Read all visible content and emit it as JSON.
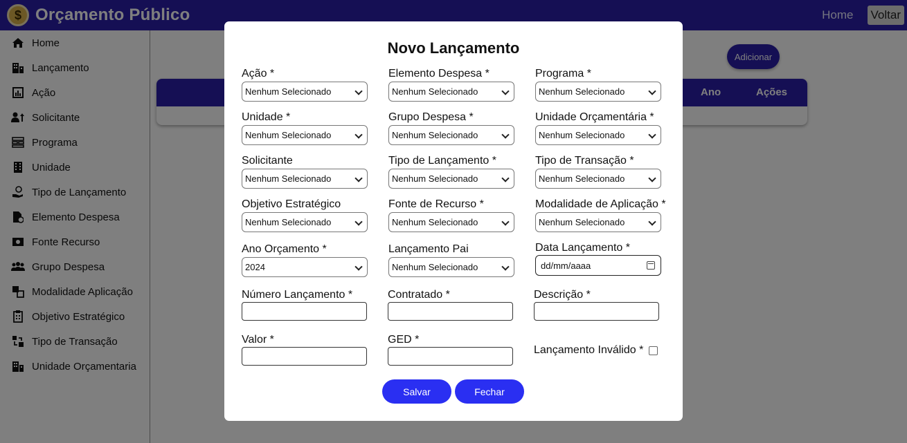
{
  "header": {
    "title": "Orçamento Público",
    "logo_symbol": "$",
    "nav_home": "Home",
    "nav_back": "Voltar"
  },
  "sidebar": {
    "items": [
      {
        "label": "Home",
        "icon": "home-icon"
      },
      {
        "label": "Lançamento",
        "icon": "building-icon"
      },
      {
        "label": "Ação",
        "icon": "bar-chart-icon"
      },
      {
        "label": "Solicitante",
        "icon": "user-up-icon"
      },
      {
        "label": "Programa",
        "icon": "sitemap-icon"
      },
      {
        "label": "Unidade",
        "icon": "office-building-icon"
      },
      {
        "label": "Tipo de Lançamento",
        "icon": "hand-coin-icon"
      },
      {
        "label": "Elemento Despesa",
        "icon": "document-money-icon"
      },
      {
        "label": "Fonte Recurso",
        "icon": "banknote-icon"
      },
      {
        "label": "Grupo Despesa",
        "icon": "users-group-icon"
      },
      {
        "label": "Modalidade Aplicação",
        "icon": "boxes-icon"
      },
      {
        "label": "Objetivo Estratégico",
        "icon": "clipboard-icon"
      },
      {
        "label": "Tipo de Transação",
        "icon": "transfer-icon"
      },
      {
        "label": "Unidade Orçamentaria",
        "icon": "buildings-icon"
      }
    ]
  },
  "main": {
    "add_button": "Adicionar",
    "table_headers": [
      "Ano",
      "Ações"
    ]
  },
  "modal": {
    "title": "Novo Lançamento",
    "selects": [
      {
        "label": "Ação *",
        "value": "Nenhum Selecionado"
      },
      {
        "label": "Elemento Despesa *",
        "value": "Nenhum Selecionado"
      },
      {
        "label": "Programa *",
        "value": "Nenhum Selecionado"
      },
      {
        "label": "Unidade *",
        "value": "Nenhum Selecionado"
      },
      {
        "label": "Grupo Despesa *",
        "value": "Nenhum Selecionado"
      },
      {
        "label": "Unidade Orçamentária *",
        "value": "Nenhum Selecionado"
      },
      {
        "label": "Solicitante",
        "value": "Nenhum Selecionado"
      },
      {
        "label": "Tipo de Lançamento *",
        "value": "Nenhum Selecionado"
      },
      {
        "label": "Tipo de Transação *",
        "value": "Nenhum Selecionado"
      },
      {
        "label": "Objetivo Estratégico",
        "value": "Nenhum Selecionado"
      },
      {
        "label": "Fonte de Recurso *",
        "value": "Nenhum Selecionado"
      },
      {
        "label": "Modalidade de Aplicação *",
        "value": "Nenhum Selecionado"
      },
      {
        "label": "Ano Orçamento *",
        "value": "2024"
      },
      {
        "label": "Lançamento Pai",
        "value": "Nenhum Selecionado"
      }
    ],
    "date": {
      "label": "Data Lançamento *",
      "placeholder": "dd/mm/aaaa"
    },
    "text_fields": [
      {
        "label": "Número Lançamento *",
        "value": ""
      },
      {
        "label": "Contratado *",
        "value": ""
      },
      {
        "label": "Descrição *",
        "value": ""
      },
      {
        "label": "Valor *",
        "value": ""
      },
      {
        "label": "GED *",
        "value": ""
      }
    ],
    "checkbox": {
      "label": "Lançamento Inválido *",
      "checked": false
    },
    "save_button": "Salvar",
    "close_button": "Fechar"
  },
  "colors": {
    "header_bg": "#2a1fa8",
    "button_bg": "#2a2ff2",
    "overlay": "rgba(0,0,0,0.5)"
  }
}
